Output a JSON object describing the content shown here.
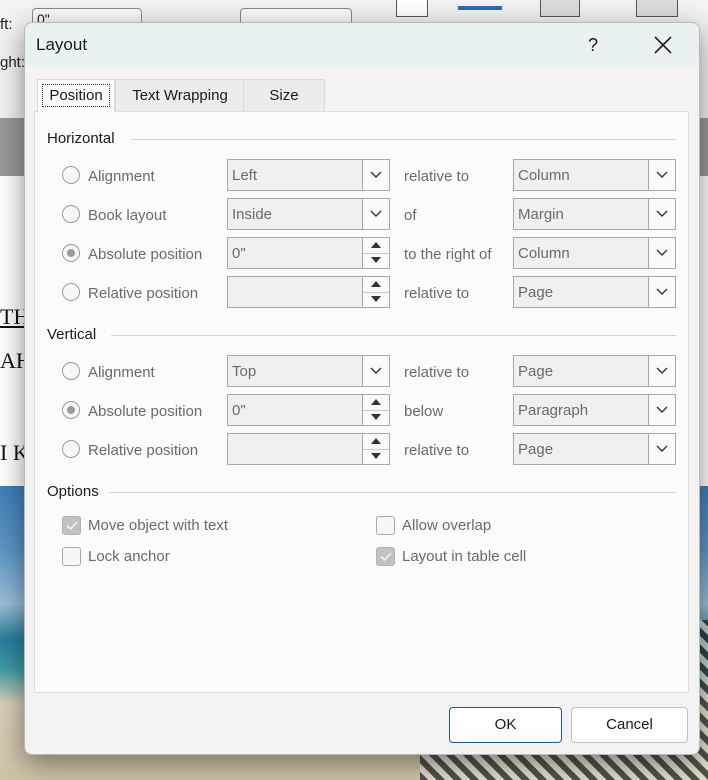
{
  "background": {
    "ribbon_left_labels": [
      "ft:",
      "ght:"
    ],
    "ribbon_field_value": "0\"",
    "doc_text_lines": [
      "TH",
      "AH",
      "I K"
    ]
  },
  "dialog": {
    "title": "Layout",
    "help_label": "?",
    "tabs": [
      "Position",
      "Text Wrapping",
      "Size"
    ],
    "horizontal": {
      "title": "Horizontal",
      "rows": [
        {
          "label": "Alignment",
          "value": "Left",
          "mid": "relative to",
          "relative": "Column",
          "checked": false,
          "spinner": false
        },
        {
          "label": "Book layout",
          "value": "Inside",
          "mid": "of",
          "relative": "Margin",
          "checked": false,
          "spinner": false
        },
        {
          "label": "Absolute position",
          "value": "0\"",
          "mid": "to the right of",
          "relative": "Column",
          "checked": true,
          "spinner": true
        },
        {
          "label": "Relative position",
          "value": "",
          "mid": "relative to",
          "relative": "Page",
          "checked": false,
          "spinner": true
        }
      ]
    },
    "vertical": {
      "title": "Vertical",
      "rows": [
        {
          "label": "Alignment",
          "value": "Top",
          "mid": "relative to",
          "relative": "Page",
          "checked": false,
          "spinner": false
        },
        {
          "label": "Absolute position",
          "value": "0\"",
          "mid": "below",
          "relative": "Paragraph",
          "checked": true,
          "spinner": true
        },
        {
          "label": "Relative position",
          "value": "",
          "mid": "relative to",
          "relative": "Page",
          "checked": false,
          "spinner": true
        }
      ]
    },
    "options": {
      "title": "Options",
      "items": [
        {
          "label": "Move object with text",
          "checked": true
        },
        {
          "label": "Allow overlap",
          "checked": false
        },
        {
          "label": "Lock anchor",
          "checked": false
        },
        {
          "label": "Layout in table cell",
          "checked": true
        }
      ]
    },
    "ok_label": "OK",
    "cancel_label": "Cancel"
  }
}
